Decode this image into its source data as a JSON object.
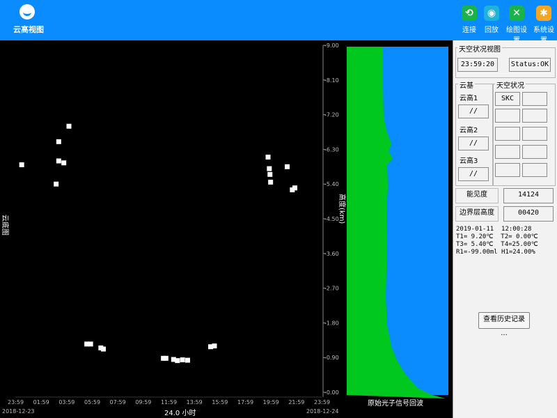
{
  "app": {
    "title": "云高视图"
  },
  "toolbar": {
    "buttons": [
      {
        "label": "连接",
        "icon": "link-icon",
        "color": "#19b34a"
      },
      {
        "label": "回放",
        "icon": "playback-icon",
        "color": "#1fb3d9"
      },
      {
        "label": "绘图设置",
        "icon": "close-x-icon",
        "color": "#19b34a"
      },
      {
        "label": "系统设置",
        "icon": "gear-icon",
        "color": "#f5a623"
      }
    ]
  },
  "plot": {
    "y_axis_label": "高度(km)",
    "x_axis_label": "24.0 小时",
    "left_label": "云底图",
    "profile_label": "原始光子信号回波",
    "start_date": "2018-12-23",
    "end_date": "2018-12-24",
    "colors": {
      "green": "#00c81e",
      "blue": "#0a8cff",
      "points": "#ffffff"
    }
  },
  "chart_data": {
    "type": "scatter",
    "xlabel": "24.0 小时",
    "ylabel": "高度(km)",
    "x_ticks": [
      "23:59",
      "01:59",
      "03:59",
      "05:59",
      "07:59",
      "09:59",
      "11:59",
      "13:59",
      "15:59",
      "17:59",
      "19:59",
      "21:59",
      "23:59"
    ],
    "y_ticks": [
      "9.00",
      "8.10",
      "7.20",
      "6.30",
      "5.40",
      "4.50",
      "3.60",
      "2.70",
      "1.80",
      "0.90",
      "0.00"
    ],
    "ylim": [
      0,
      9
    ],
    "points": [
      {
        "x": 0.5,
        "y": 5.9
      },
      {
        "x": 3.2,
        "y": 5.4
      },
      {
        "x": 3.4,
        "y": 6.5
      },
      {
        "x": 3.4,
        "y": 6.0
      },
      {
        "x": 3.8,
        "y": 5.95
      },
      {
        "x": 4.2,
        "y": 6.9
      },
      {
        "x": 5.6,
        "y": 1.25
      },
      {
        "x": 5.9,
        "y": 1.25
      },
      {
        "x": 6.7,
        "y": 1.15
      },
      {
        "x": 6.9,
        "y": 1.12
      },
      {
        "x": 11.6,
        "y": 0.88
      },
      {
        "x": 11.8,
        "y": 0.88
      },
      {
        "x": 12.4,
        "y": 0.85
      },
      {
        "x": 12.7,
        "y": 0.82
      },
      {
        "x": 13.1,
        "y": 0.84
      },
      {
        "x": 13.5,
        "y": 0.83
      },
      {
        "x": 15.3,
        "y": 1.18
      },
      {
        "x": 15.6,
        "y": 1.2
      },
      {
        "x": 19.8,
        "y": 6.1
      },
      {
        "x": 19.9,
        "y": 5.8
      },
      {
        "x": 19.95,
        "y": 5.65
      },
      {
        "x": 20.0,
        "y": 5.45
      },
      {
        "x": 21.3,
        "y": 5.85
      },
      {
        "x": 21.7,
        "y": 5.25
      },
      {
        "x": 21.9,
        "y": 5.3
      }
    ]
  },
  "status": {
    "sky_view_title": "天空状况视图",
    "time": "23:59:20",
    "status_text": "Status:OK",
    "cloud_base_title": "云基",
    "sky_condition_title": "天空状况",
    "cloud1_label": "云高1",
    "cloud1_value": "//",
    "cloud2_label": "云高2",
    "cloud2_value": "//",
    "cloud3_label": "云高3",
    "cloud3_value": "//",
    "sky_value": "SKC",
    "visibility_label": "能见度",
    "visibility_value": "14124",
    "boundary_label": "边界层高度",
    "boundary_value": "00420",
    "readout": "2019-01-11  12:00:28\nT1= 9.20℃  T2= 0.00℃\nT3= 5.40℃  T4=25.00℃\nR1=-99.00ml H1=24.00%",
    "history_button": "查看历史记录 ..."
  }
}
